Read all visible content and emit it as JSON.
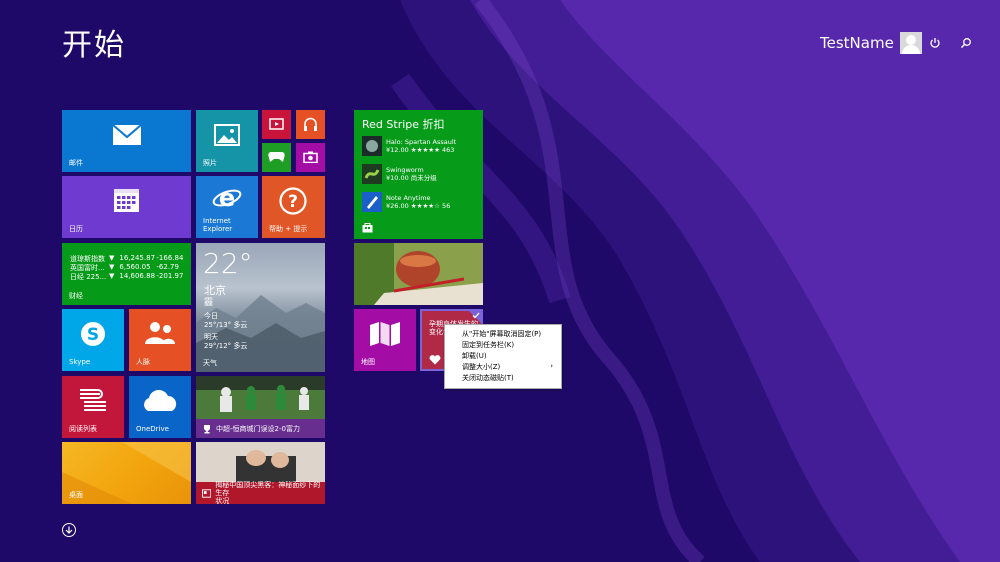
{
  "header": {
    "title": "开始",
    "username": "TestName"
  },
  "tiles": {
    "mail": "邮件",
    "photos": "照片",
    "calendar": "日历",
    "ie": "Internet\nExplorer",
    "help": "帮助 + 提示",
    "finance": {
      "label": "财经",
      "rows": [
        {
          "name": "道琼斯指数",
          "arrow": "▼",
          "value": "16,245.87",
          "change": "-166.84"
        },
        {
          "name": "英国富时...",
          "arrow": "▼",
          "value": "6,560.05",
          "change": "-62.79"
        },
        {
          "name": "日经 225...",
          "arrow": "▼",
          "value": "14,606.88",
          "change": "-201.97"
        }
      ]
    },
    "weather": {
      "label": "天气",
      "temp": "22°",
      "city": "北京",
      "condition": "霾",
      "today_label": "今日",
      "today": "25°/13° 多云",
      "tomorrow_label": "明天",
      "tomorrow": "29°/12° 多云"
    },
    "skype": "Skype",
    "people": "人脉",
    "reading": "阅读列表",
    "onedrive": "OneDrive",
    "sports": "中超-恒商城门误设2-0富力",
    "desktop": "桌面",
    "news": "揭秘中国顶尖黑客：神秘面纱下的生存\n状况",
    "store": {
      "title": "Red Stripe 折扣",
      "items": [
        {
          "name": "Halo: Spartan Assault",
          "price": "¥12.00 ★★★★★ 463"
        },
        {
          "name": "Swingworm",
          "price": "¥10.00 尚未分级"
        },
        {
          "name": "Note Anytime",
          "price": "¥26.00 ★★★★☆ 56"
        }
      ]
    },
    "maps": "地图",
    "health": "孕期身体发生的\n变化会..."
  },
  "context_menu": {
    "items": [
      "从\"开始\"屏幕取消固定(P)",
      "固定到任务栏(K)",
      "卸载(U)",
      "调整大小(Z)",
      "关闭动态磁贴(T)"
    ],
    "submenu_arrow": "›"
  },
  "colors": {
    "background": "#1f0968",
    "mail": "#0a78d1",
    "photos": "#1594a8",
    "calendar": "#6e3ad0",
    "ie": "#1b78d4",
    "help": "#e05626",
    "finance": "#059a17",
    "skype": "#00a7e8",
    "people": "#e55124",
    "reading": "#c2163a",
    "onedrive": "#0a65c9",
    "desktop": "#f2a40c",
    "store": "#069b19",
    "maps": "#a30ca5"
  }
}
